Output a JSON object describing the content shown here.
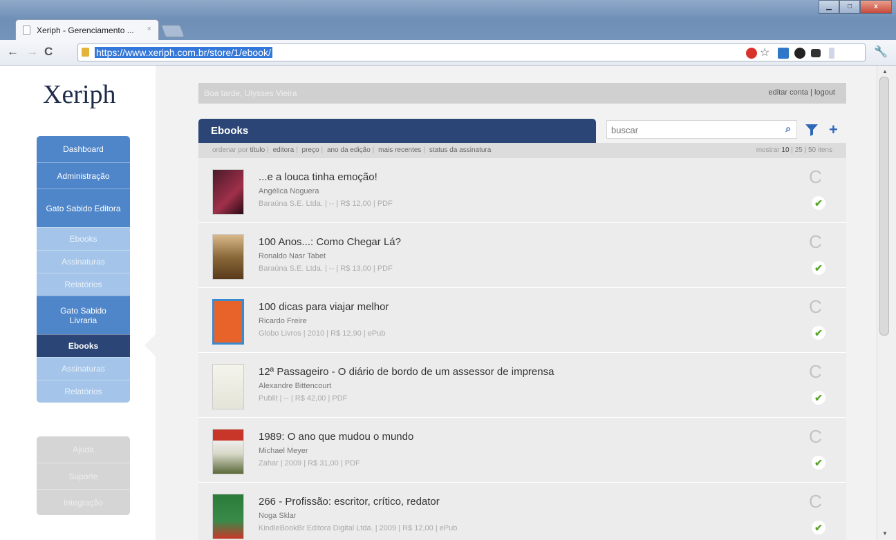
{
  "browser": {
    "tab_title": "Xeriph - Gerenciamento ...",
    "tab_close": "×",
    "url": "https://www.xeriph.com.br/store/1/ebook/",
    "win_min": "▁",
    "win_max": "□",
    "win_close": "x"
  },
  "logo": "Xeriph",
  "sidebar": {
    "dashboard": "Dashboard",
    "administracao": "Administração",
    "gato_editora": "Gato Sabido Editora",
    "ed_ebooks": "Ebooks",
    "ed_assinaturas": "Assinaturas",
    "ed_relatorios": "Relatórios",
    "gato_livraria": "Gato Sabido Livraria",
    "lv_ebooks": "Ebooks",
    "lv_assinaturas": "Assinaturas",
    "lv_relatorios": "Relatórios"
  },
  "help": {
    "ajuda": "Ajuda",
    "suporte": "Suporte",
    "integracao": "Integração"
  },
  "header": {
    "greeting": "Boa tarde, Ulysses Vieira",
    "edit_account": "editar conta",
    "sep": "|",
    "logout": "logout"
  },
  "section_title": "Ebooks",
  "search": {
    "placeholder": "buscar"
  },
  "sort": {
    "prefix": "ordenar por",
    "options": [
      "título",
      "editora",
      "preço",
      "ano da edição",
      "mais recentes",
      "status da assinatura"
    ],
    "show_prefix": "mostrar",
    "counts": [
      "10",
      "25",
      "50"
    ],
    "suffix": "itens"
  },
  "books": [
    {
      "title": "...e a louca tinha emoção!",
      "author": "Angélica Noguera",
      "meta": "Baraúna S.E. Ltda. | -- | R$ 12,00 | PDF",
      "status": "C"
    },
    {
      "title": "100 Anos...: Como Chegar Lá?",
      "author": "Ronaldo Nasr Tabet",
      "meta": "Baraúna S.E. Ltda. | -- | R$ 13,00 | PDF",
      "status": "C"
    },
    {
      "title": "100 dicas para viajar melhor",
      "author": "Ricardo Freire",
      "meta": "Globo Livros | 2010 | R$ 12,90 | ePub",
      "status": "C"
    },
    {
      "title": "12ª Passageiro - O diário de bordo de um assessor de imprensa",
      "author": "Alexandre Bittencourt",
      "meta": "Publit | -- | R$ 42,00 | PDF",
      "status": "C"
    },
    {
      "title": "1989: O ano que mudou o mundo",
      "author": "Michael Meyer",
      "meta": "Zahar | 2009 | R$ 31,00 | PDF",
      "status": "C"
    },
    {
      "title": "266 - Profissão: escritor, crítico, redator",
      "author": "Noga Sklar",
      "meta": "KindleBookBr Editora Digital Ltda. | 2009 | R$ 12,00 | ePub",
      "status": "C"
    }
  ],
  "colors": {
    "navy": "#2b4676",
    "sidebar_blue": "#4f86c9",
    "sidebar_light": "#a4c5e9",
    "check_green": "#58a42b"
  }
}
